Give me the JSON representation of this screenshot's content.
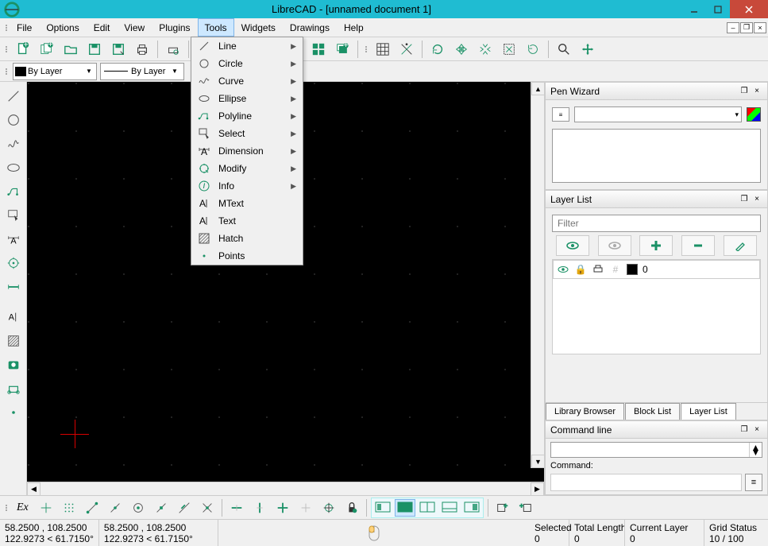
{
  "window": {
    "title": "LibreCAD - [unnamed document 1]"
  },
  "menubar": {
    "items": [
      "File",
      "Options",
      "Edit",
      "View",
      "Plugins",
      "Tools",
      "Widgets",
      "Drawings",
      "Help"
    ],
    "active": "Tools"
  },
  "tools_menu": [
    {
      "label": "Line",
      "icon": "line",
      "sub": true
    },
    {
      "label": "Circle",
      "icon": "circle",
      "sub": true
    },
    {
      "label": "Curve",
      "icon": "curve",
      "sub": true
    },
    {
      "label": "Ellipse",
      "icon": "ellipse",
      "sub": true
    },
    {
      "label": "Polyline",
      "icon": "polyline",
      "sub": true
    },
    {
      "label": "Select",
      "icon": "select",
      "sub": true
    },
    {
      "label": "Dimension",
      "icon": "dimension",
      "sub": true
    },
    {
      "label": "Modify",
      "icon": "modify",
      "sub": true
    },
    {
      "label": "Info",
      "icon": "info",
      "sub": true
    },
    {
      "label": "MText",
      "icon": "mtext",
      "sub": false
    },
    {
      "label": "Text",
      "icon": "text",
      "sub": false
    },
    {
      "label": "Hatch",
      "icon": "hatch",
      "sub": false
    },
    {
      "label": "Points",
      "icon": "points",
      "sub": false
    }
  ],
  "toolbar_pen": {
    "color_label": "By Layer",
    "linetype_label": "By Layer"
  },
  "right": {
    "pen_wizard": {
      "title": "Pen Wizard"
    },
    "layer_list": {
      "title": "Layer List",
      "filter_placeholder": "Filter",
      "layer0": "0"
    },
    "tabs": {
      "library": "Library Browser",
      "block": "Block List",
      "layer": "Layer List"
    },
    "cmd": {
      "title": "Command line",
      "label": "Command:"
    }
  },
  "status": {
    "abs1": "58.2500 , 108.2500",
    "abs2": "122.9273 < 61.7150°",
    "rel1": "58.2500 , 108.2500",
    "rel2": "122.9273 < 61.7150°",
    "selected_label": "Selected",
    "selected_val": "0",
    "total_label": "Total Length",
    "total_val": "0",
    "layer_label": "Current Layer",
    "layer_val": "0",
    "grid_label": "Grid Status",
    "grid_val": "10 / 100"
  },
  "bottom": {
    "ex": "Ex"
  },
  "colors": {
    "accent": "#1a9166"
  }
}
